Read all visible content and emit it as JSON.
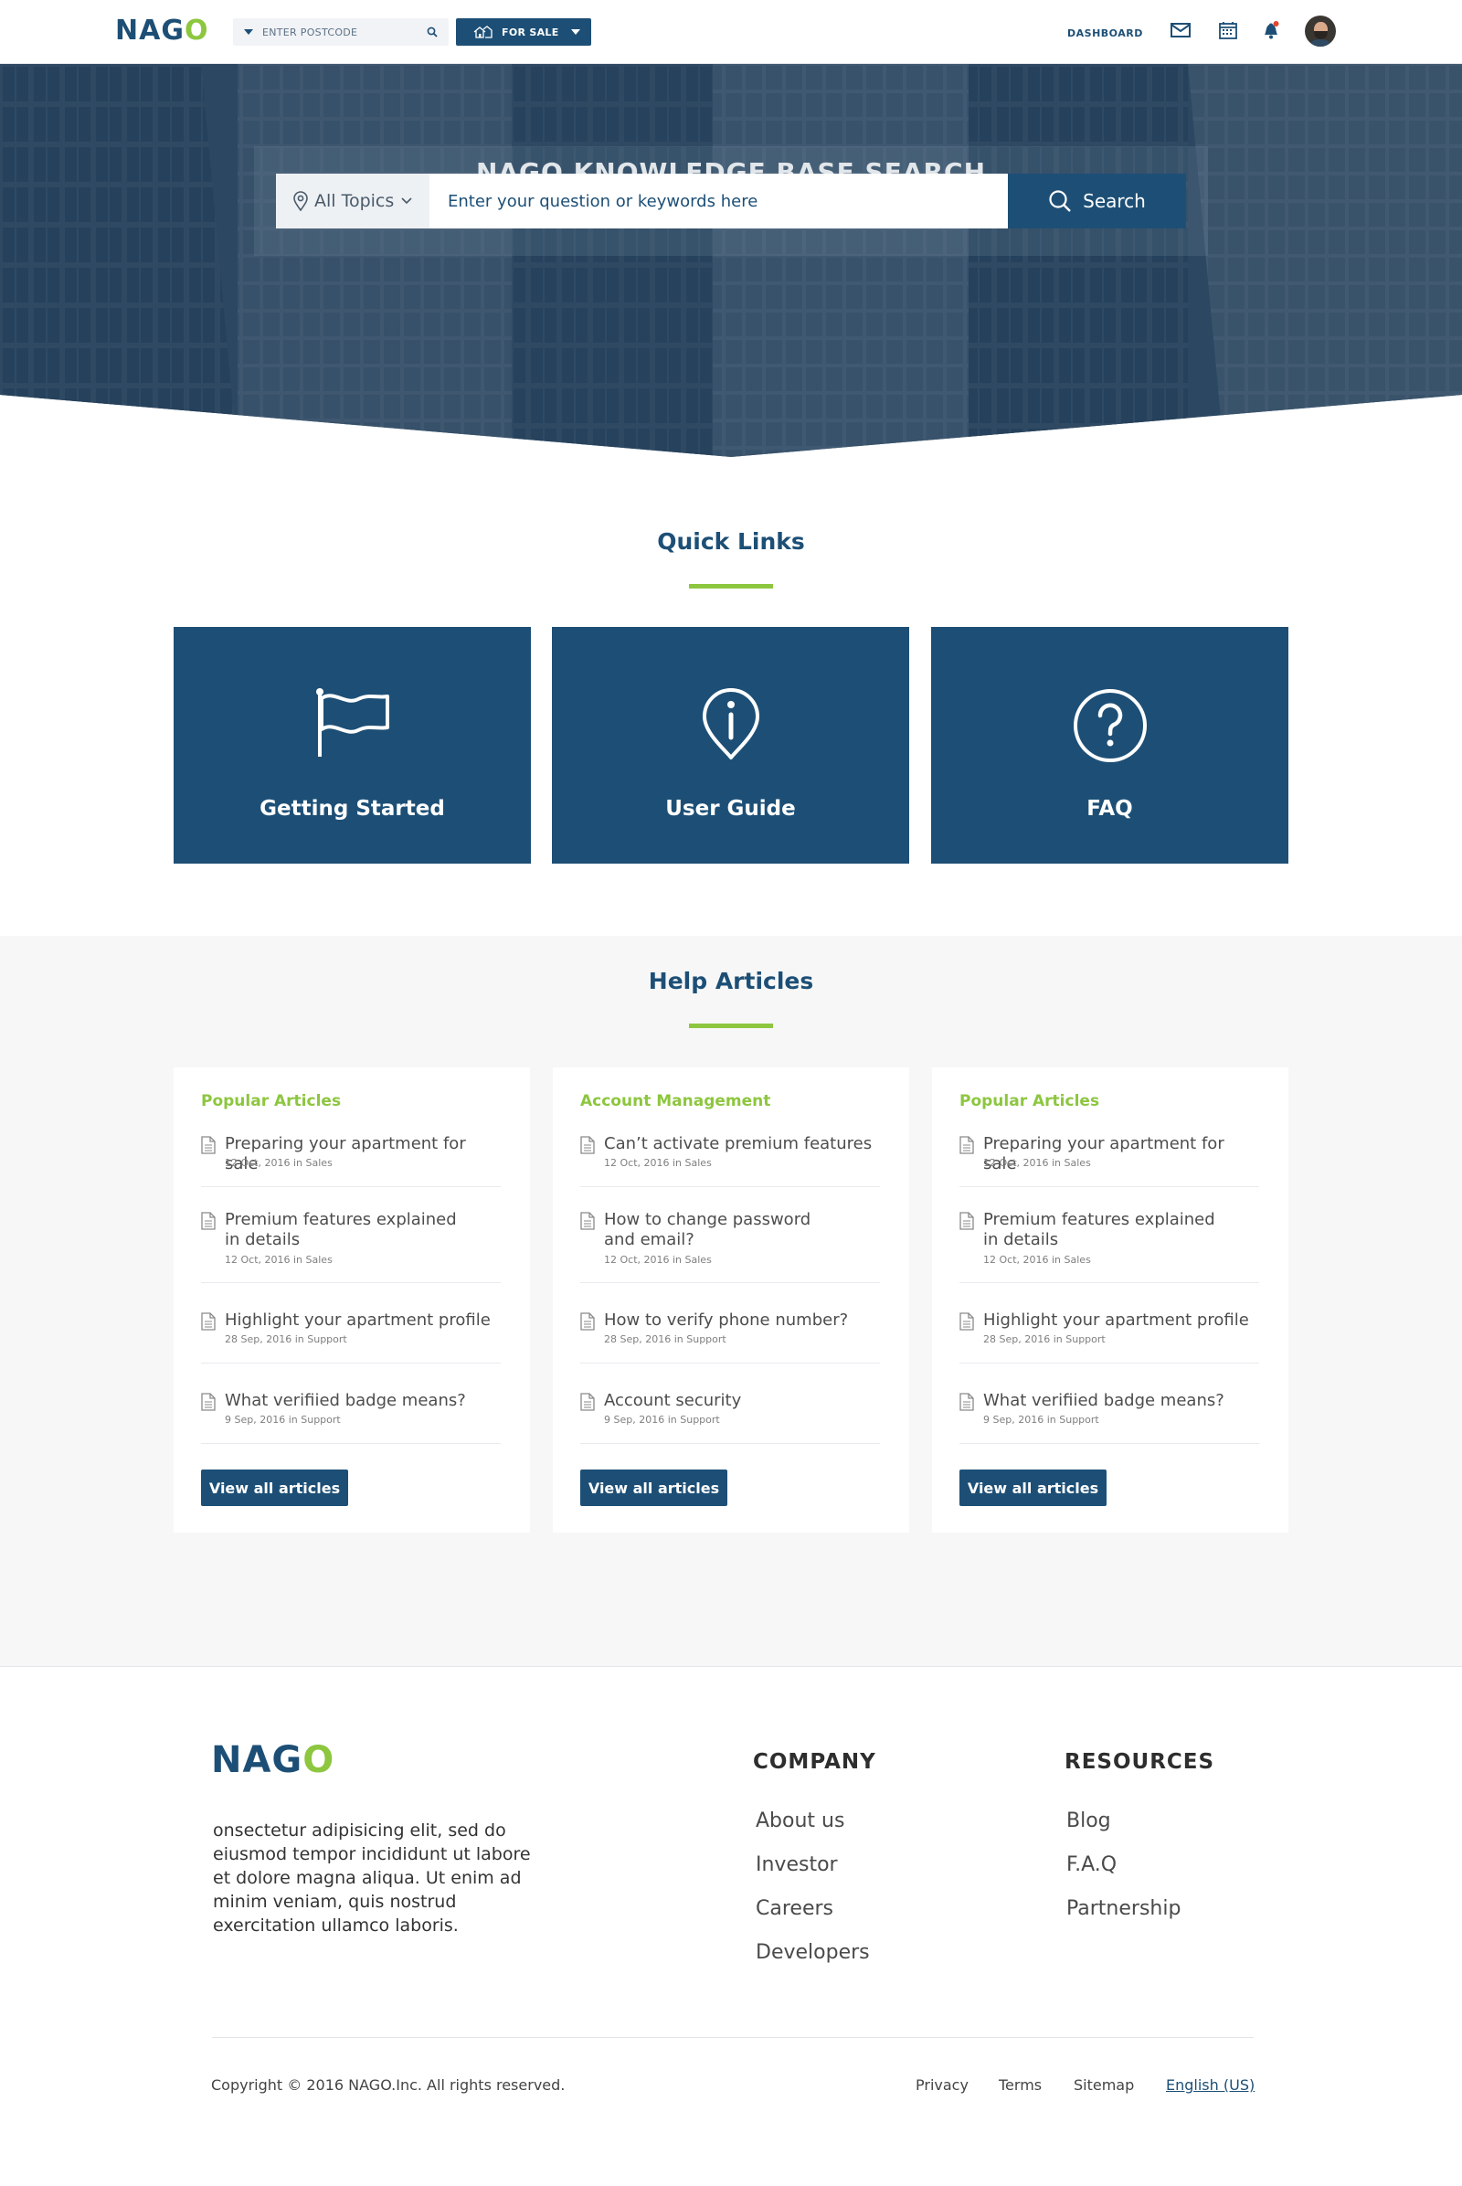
{
  "header": {
    "logo_prefix": "NAG",
    "logo_suffix": "O",
    "postcode_placeholder": "ENTER POSTCODE",
    "listing_type": "FOR SALE",
    "dashboard_label": "DASHBOARD",
    "icons": [
      "mail-icon",
      "calendar-icon",
      "bell-icon"
    ]
  },
  "hero": {
    "title": "NAGO KNOWLEDGE BASE SEARCH",
    "topics_label": "All Topics",
    "search_placeholder": "Enter your question or keywords here",
    "search_button": "Search"
  },
  "quick_links": {
    "title": "Quick Links",
    "items": [
      {
        "label": "Getting Started",
        "icon": "flag-icon"
      },
      {
        "label": "User Guide",
        "icon": "info-pin-icon"
      },
      {
        "label": "FAQ",
        "icon": "question-icon"
      }
    ]
  },
  "help_articles": {
    "title": "Help Articles",
    "columns": [
      {
        "category": "Popular Articles",
        "articles": [
          {
            "title": "Preparing your apartment for sale",
            "meta": "12 Oct, 2016 in Sales"
          },
          {
            "title": "Premium features explained in details",
            "meta": "12 Oct, 2016 in Sales"
          },
          {
            "title": "Highlight your apartment profile",
            "meta": "28 Sep, 2016 in Support"
          },
          {
            "title": "What verifiied badge means?",
            "meta": "9 Sep, 2016 in Support"
          }
        ],
        "button": "View all articles"
      },
      {
        "category": "Account Management",
        "articles": [
          {
            "title": "Can’t activate premium features",
            "meta": "12 Oct, 2016 in Sales"
          },
          {
            "title": "How to change password and email?",
            "meta": "12 Oct, 2016 in Sales"
          },
          {
            "title": "How to verify phone number?",
            "meta": "28 Sep, 2016 in Support"
          },
          {
            "title": "Account security",
            "meta": "9 Sep, 2016 in Support"
          }
        ],
        "button": "View all articles"
      },
      {
        "category": "Popular Articles",
        "articles": [
          {
            "title": "Preparing your apartment for sale",
            "meta": "12 Oct, 2016 in Sales"
          },
          {
            "title": "Premium features explained in details",
            "meta": "12 Oct, 2016 in Sales"
          },
          {
            "title": "Highlight your apartment profile",
            "meta": "28 Sep, 2016 in Support"
          },
          {
            "title": "What verifiied badge means?",
            "meta": "9 Sep, 2016 in Support"
          }
        ],
        "button": "View all articles"
      }
    ]
  },
  "footer": {
    "logo_prefix": "NAG",
    "logo_suffix": "O",
    "description": "onsectetur adipisicing elit, sed do eiusmod tempor incididunt ut labore et dolore magna aliqua. Ut enim ad minim veniam, quis nostrud exercitation ullamco laboris.",
    "company_title": "COMPANY",
    "company_links": [
      "About us",
      "Investor",
      "Careers",
      "Developers"
    ],
    "resources_title": "RESOURCES",
    "resources_links": [
      "Blog",
      "F.A.Q",
      "Partnership"
    ],
    "copyright": "Copyright © 2016 NAGO.Inc. All rights reserved.",
    "bottom_links": [
      "Privacy",
      "Terms",
      "Sitemap"
    ],
    "language": "English (US)"
  },
  "colors": {
    "brand_blue": "#1d4f76",
    "accent_green": "#8dc63f",
    "section_bg": "#f7f7f7"
  }
}
